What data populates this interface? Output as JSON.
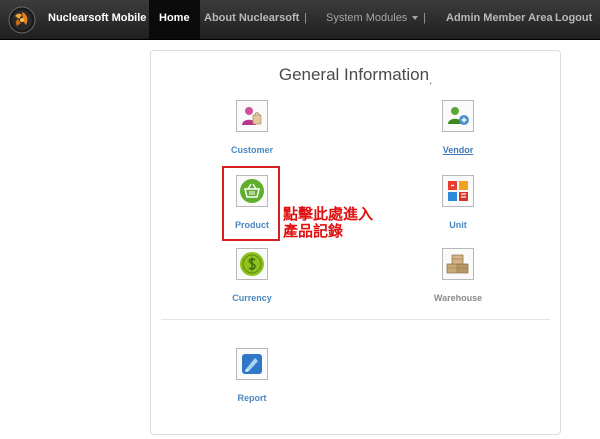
{
  "navbar": {
    "brand": "Nuclearsoft Mobile ERP",
    "items": [
      {
        "label": "Home"
      },
      {
        "label": "About Nuclearsoft"
      },
      {
        "label": "System Modules"
      },
      {
        "label": "Admin Member Area"
      },
      {
        "label": "Logout"
      }
    ],
    "separator": "|"
  },
  "panel": {
    "title": "General Information",
    "title_suffix": ".",
    "modules": [
      {
        "label": "Customer",
        "icon": "customer-icon"
      },
      {
        "label": "Vendor",
        "icon": "vendor-icon"
      },
      {
        "label": "Product",
        "icon": "basket-icon"
      },
      {
        "label": "Unit",
        "icon": "unit-icon"
      },
      {
        "label": "Currency",
        "icon": "currency-icon"
      },
      {
        "label": "Warehouse",
        "icon": "boxes-icon"
      },
      {
        "label": "Report",
        "icon": "report-icon"
      }
    ]
  },
  "annotation": {
    "line1": "點擊此處進入",
    "line2": "產品記錄",
    "color": "#e01010"
  },
  "colors": {
    "navbar": "#2b2b2b",
    "link": "#4c87c0"
  }
}
